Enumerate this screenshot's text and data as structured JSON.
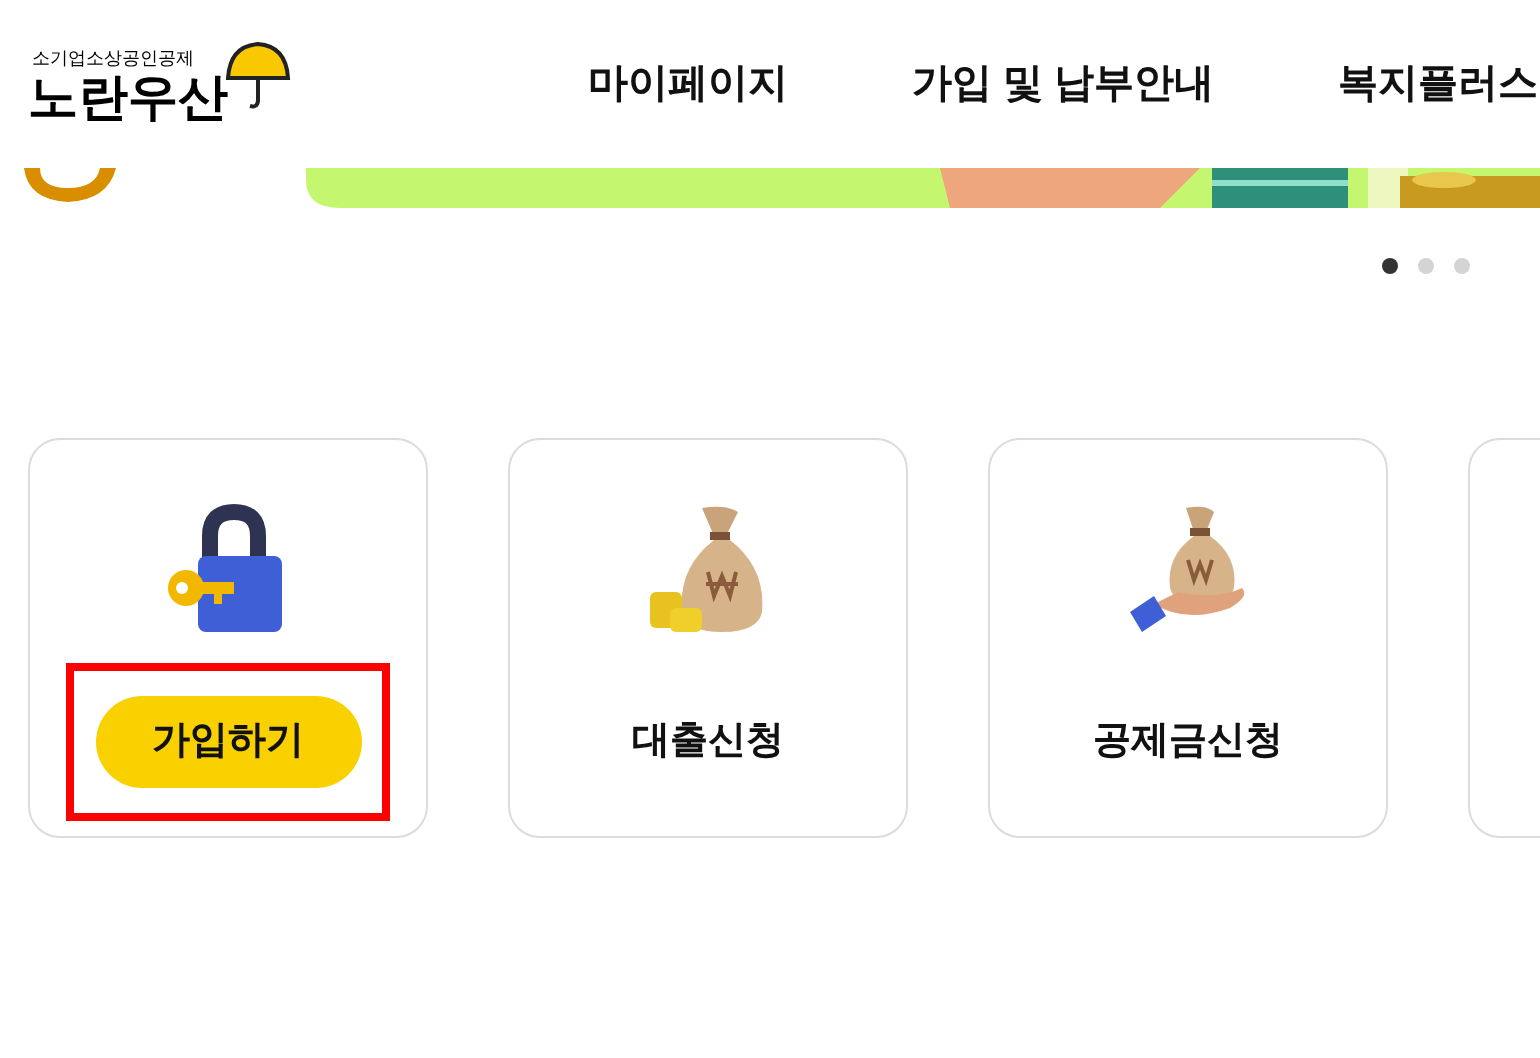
{
  "header": {
    "logo": {
      "subtitle": "소기업소상공인공제",
      "title": "노란우산"
    },
    "nav": [
      "마이페이지",
      "가입 및 납부안내",
      "복지플러스"
    ]
  },
  "banner": {
    "dots": [
      {
        "selected": true
      },
      {
        "selected": false
      },
      {
        "selected": false
      }
    ]
  },
  "cards": [
    {
      "kind": "button",
      "label": "가입하기",
      "highlighted": true
    },
    {
      "kind": "label",
      "label": "대출신청",
      "highlighted": false
    },
    {
      "kind": "label",
      "label": "공제금신청",
      "highlighted": false
    }
  ]
}
